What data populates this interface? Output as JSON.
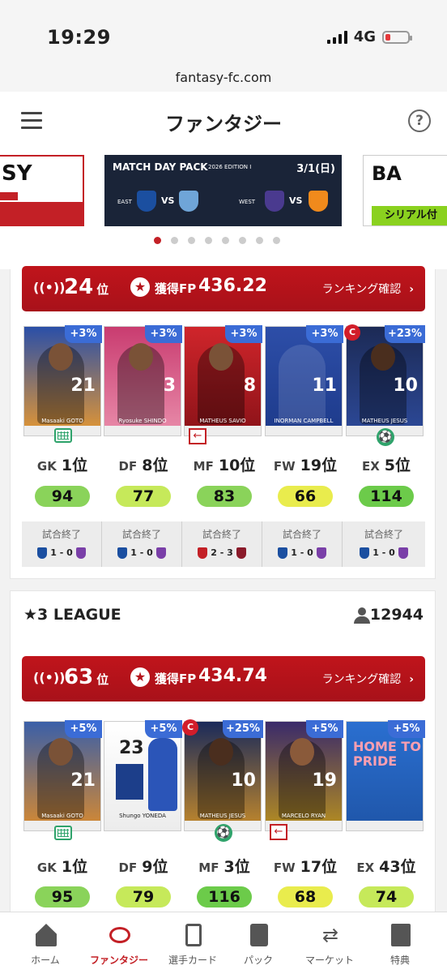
{
  "status_bar": {
    "time": "19:29",
    "network": "4G"
  },
  "url": "fantasy-fc.com",
  "header": {
    "title": "ファンタジー",
    "help": "?"
  },
  "carousel": {
    "left_banner_text": "SY",
    "main_banner": {
      "title": "MATCH DAY PACK",
      "edition": "2026 EDITION I",
      "date": "3/1(日)",
      "east_label": "EAST",
      "west_label": "WEST",
      "vs": "VS"
    },
    "right_banner_text": "BA",
    "right_banner_sub": "シリアル付",
    "dots": 8,
    "active_dot": 0
  },
  "leagues": [
    {
      "rank": "24",
      "rank_suffix": "位",
      "fp_label": "獲得FP",
      "fp": "436.22",
      "ranking_link": "ランキング確認",
      "players": [
        {
          "bonus": "+3%",
          "number": "21",
          "name": "Masaaki GOTO",
          "captain": false,
          "badge": "gk"
        },
        {
          "bonus": "+3%",
          "number": "3",
          "name": "Ryosuke SHINDO",
          "captain": false,
          "badge": ""
        },
        {
          "bonus": "+3%",
          "number": "8",
          "name": "MATHEUS SAVIO",
          "captain": false,
          "badge": "out"
        },
        {
          "bonus": "+3%",
          "number": "11",
          "name": "INORMAN CAMPBELL",
          "captain": false,
          "badge": ""
        },
        {
          "bonus": "+23%",
          "number": "10",
          "name": "MATHEUS JESUS",
          "captain": true,
          "captain_label": "C",
          "badge": "ball"
        }
      ],
      "positions": [
        {
          "pos": "GK",
          "rank": "1位",
          "score": "94"
        },
        {
          "pos": "DF",
          "rank": "8位",
          "score": "77"
        },
        {
          "pos": "MF",
          "rank": "10位",
          "score": "83"
        },
        {
          "pos": "FW",
          "rank": "19位",
          "score": "66"
        },
        {
          "pos": "EX",
          "rank": "5位",
          "score": "114"
        }
      ],
      "matches": [
        {
          "status": "試合終了",
          "score": "1 - 0"
        },
        {
          "status": "試合終了",
          "score": "1 - 0"
        },
        {
          "status": "試合終了",
          "score": "2 - 3"
        },
        {
          "status": "試合終了",
          "score": "1 - 0"
        },
        {
          "status": "試合終了",
          "score": "1 - 0"
        }
      ]
    },
    {
      "name": "★3 LEAGUE",
      "participants": "12944",
      "rank": "63",
      "rank_suffix": "位",
      "fp_label": "獲得FP",
      "fp": "434.74",
      "ranking_link": "ランキング確認",
      "players": [
        {
          "bonus": "+5%",
          "number": "21",
          "name": "Masaaki GOTO",
          "captain": false,
          "badge": "gk"
        },
        {
          "bonus": "+5%",
          "number": "23",
          "name": "Shungo YONEDA",
          "captain": false,
          "badge": ""
        },
        {
          "bonus": "+25%",
          "number": "10",
          "name": "MATHEUS JESUS",
          "captain": true,
          "captain_label": "C",
          "badge": "ball"
        },
        {
          "bonus": "+5%",
          "number": "19",
          "name": "MARCELO RYAN",
          "captain": false,
          "badge": "out"
        },
        {
          "bonus": "+5%",
          "number": "",
          "name": "HOME TO PRIDE",
          "captain": false,
          "badge": ""
        }
      ],
      "positions": [
        {
          "pos": "GK",
          "rank": "1位",
          "score": "95"
        },
        {
          "pos": "DF",
          "rank": "9位",
          "score": "79"
        },
        {
          "pos": "MF",
          "rank": "3位",
          "score": "116"
        },
        {
          "pos": "FW",
          "rank": "17位",
          "score": "68"
        },
        {
          "pos": "EX",
          "rank": "43位",
          "score": "74"
        }
      ]
    }
  ],
  "bottom_nav": [
    {
      "label": "ホーム",
      "icon": "home-icon"
    },
    {
      "label": "ファンタジー",
      "icon": "stadium-icon",
      "active": true
    },
    {
      "label": "選手カード",
      "icon": "cards-icon"
    },
    {
      "label": "パック",
      "icon": "pack-icon"
    },
    {
      "label": "マーケット",
      "icon": "exchange-icon"
    },
    {
      "label": "特典",
      "icon": "gift-icon"
    }
  ],
  "colors": {
    "brand_red": "#c32026",
    "pill_green": "#8ad35a",
    "pill_lime": "#c6e95a",
    "pill_yellow": "#e9ec4d",
    "bonus_blue": "#3b6cd6"
  }
}
